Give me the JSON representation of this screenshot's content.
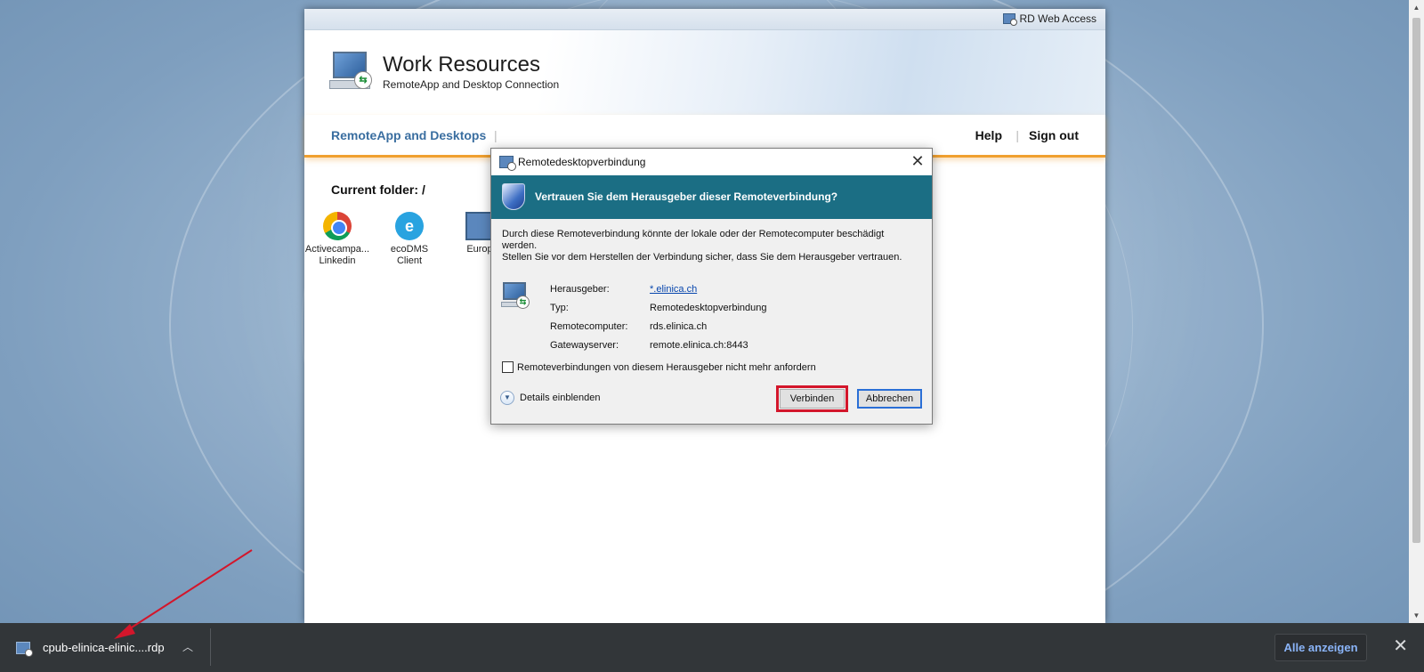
{
  "page": {
    "topbar": {
      "rd_web_access_label": "RD Web Access"
    },
    "banner": {
      "title": "Work Resources",
      "subtitle": "RemoteApp and Desktop Connection"
    },
    "nav": {
      "remoteapp_label": "RemoteApp and Desktops",
      "separator": "|",
      "help_label": "Help",
      "signout_label": "Sign out"
    },
    "folder": {
      "label": "Current folder:",
      "path": "/"
    },
    "apps": [
      {
        "name_line1": "Activecampa...",
        "name_line2": "Linkedin",
        "icon": "chrome-icon"
      },
      {
        "name_line1": "ecoDMS",
        "name_line2": "Client",
        "icon": "ecodms-icon"
      },
      {
        "name_line1": "Europ",
        "name_line2": "",
        "icon": "remote-desktop-icon"
      }
    ]
  },
  "dialog": {
    "title": "Remotedesktopverbindung",
    "close_glyph": "✕",
    "header_question": "Vertrauen Sie dem Herausgeber dieser Remoteverbindung?",
    "message_line1": "Durch diese Remoteverbindung könnte der lokale oder der Remotecomputer beschädigt werden.",
    "message_line2": "Stellen Sie vor dem Herstellen der Verbindung sicher, dass Sie dem Herausgeber vertrauen.",
    "info": [
      {
        "key": "Herausgeber:",
        "value": "*.elinica.ch"
      },
      {
        "key": "Typ:",
        "value": "Remotedesktopverbindung"
      },
      {
        "key": "Remotecomputer:",
        "value": "rds.elinica.ch"
      },
      {
        "key": "Gatewayserver:",
        "value": "remote.elinica.ch:8443"
      }
    ],
    "checkbox_label": "Remoteverbindungen von diesem Herausgeber nicht mehr anfordern",
    "checkbox_checked": false,
    "details_label": "Details einblenden",
    "connect_label": "Verbinden",
    "cancel_label": "Abbrechen"
  },
  "download_bar": {
    "file_name": "cpub-elinica-elinic....rdp",
    "show_all_label": "Alle anzeigen",
    "close_glyph": "✕"
  },
  "colors": {
    "dialog_header": "#1b6e84",
    "annotation_red": "#d3162b",
    "nav_accent": "#f0a030",
    "download_bar": "#323639"
  }
}
